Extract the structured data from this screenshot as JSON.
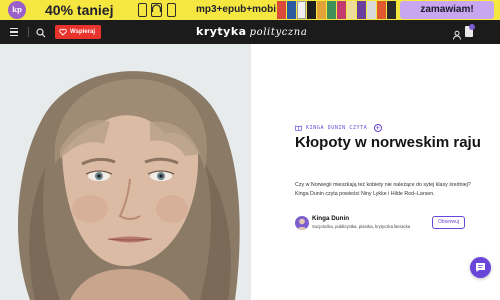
{
  "banner": {
    "logo_text": "kp",
    "discount": "40% taniej",
    "formats": "mp3+epub+mobi",
    "cta": "zamawiam!",
    "background": "#f5e640",
    "cta_background": "#c9a6f0"
  },
  "nav": {
    "menu_icon": "hamburger-icon",
    "search_icon": "search-icon",
    "support_label": "Wspieraj",
    "support_color": "#e8342d",
    "logo_part1": "krytyka",
    "logo_part2": "polityczna",
    "user_icon": "user-icon",
    "bookmark_icon": "bookmark-icon"
  },
  "article": {
    "category": "KINGA DUNIN CZYTA",
    "category_icon": "book-icon",
    "title": "Kłopoty w norweskim raju",
    "lead": "Czy w Norwegii mieszkają też kobiety nie należące do sytej klasy średniej? Kinga Dunin czyta powieści Niny Lykke i Hilde Rod–Larsen.",
    "author": {
      "name": "Kinga Dunin",
      "bio": "Socjolożka, publicystka, pisarka, krytyczka literacka",
      "follow_label": "Obserwuj"
    },
    "accent_color": "#6a46d8"
  },
  "chat": {
    "icon": "chat-icon"
  }
}
